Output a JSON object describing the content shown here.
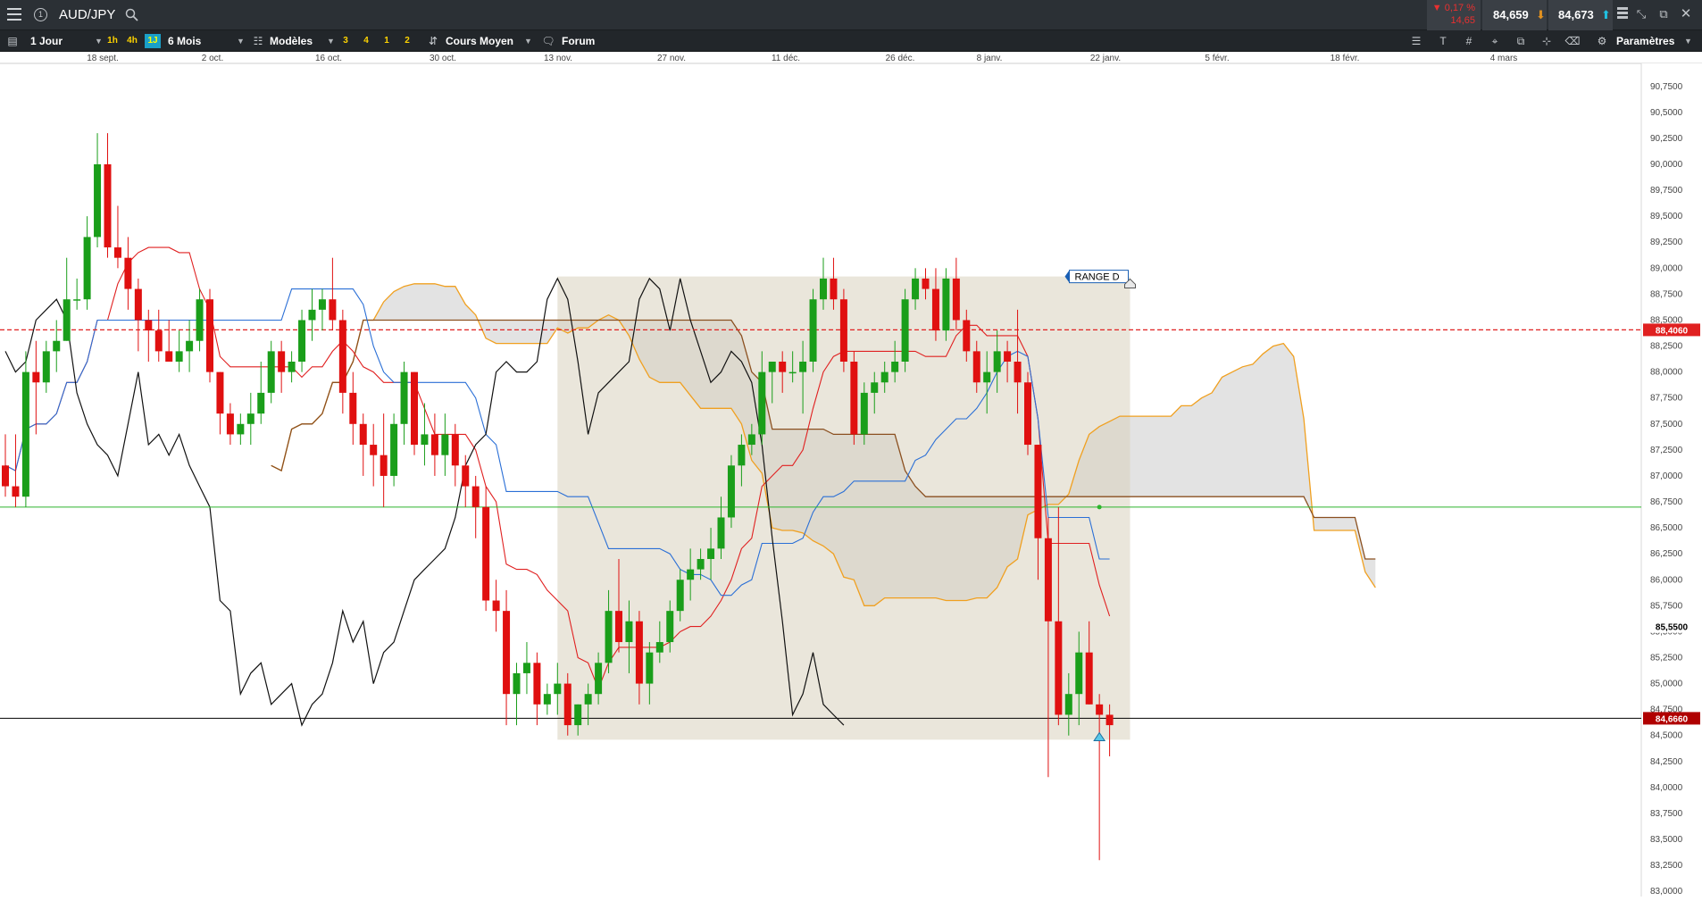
{
  "header": {
    "symbol": "AUD/JPY",
    "change_pct": "▼ 0,17 %",
    "change_pts": "14,65",
    "sell_price": "84,659",
    "buy_price": "84,673"
  },
  "toolbar": {
    "timeframe": "1 Jour",
    "quick_1h": "1h",
    "quick_4h": "4h",
    "quick_1j": "1J",
    "period": "6 Mois",
    "templates": "Modèles",
    "preset_3": "3",
    "preset_4": "4",
    "preset_1": "1",
    "preset_2": "2",
    "price_type": "Cours Moyen",
    "forum": "Forum",
    "settings": "Paramètres"
  },
  "chart_data": {
    "type": "candlestick",
    "symbol": "AUD/JPY",
    "x_tick_labels": [
      "18 sept.",
      "2 oct.",
      "16 oct.",
      "30 oct.",
      "13 nov.",
      "27 nov.",
      "11 déc.",
      "26 déc.",
      "8 janv.",
      "22 janv.",
      "5 févr.",
      "18 févr.",
      "4 mars"
    ],
    "y_tick_labels": [
      "90,7500",
      "90,5000",
      "90,2500",
      "90,0000",
      "89,7500",
      "89,5000",
      "89,2500",
      "89,0000",
      "88,7500",
      "88,5000",
      "88,2500",
      "88,0000",
      "87,7500",
      "87,5000",
      "87,2500",
      "87,0000",
      "86,7500",
      "86,5000",
      "86,2500",
      "86,0000",
      "85,7500",
      "85,5000",
      "85,2500",
      "85,0000",
      "84,7500",
      "84,5000",
      "84,2500",
      "84,0000",
      "83,7500",
      "83,5000",
      "83,2500",
      "83,0000"
    ],
    "ylim": [
      82.95,
      90.92
    ],
    "horizontal_lines": {
      "resistance": {
        "value": 88.406,
        "label": "88,4060",
        "color": "#e02020",
        "style": "dashed"
      },
      "alert_level": {
        "value": 85.55,
        "label": "85,5500",
        "color": "#000000"
      },
      "current_price": {
        "value": 84.666,
        "label": "84,6660",
        "color": "#b00000"
      },
      "green_level": {
        "value": 86.7,
        "color": "#2db52d"
      }
    },
    "range_box": {
      "label": "RANGE D",
      "top": 88.92,
      "bottom": 84.46,
      "color": "#d8d2bd"
    },
    "colors": {
      "up": "#1a9e1a",
      "down": "#e01010",
      "tenkan": "#e02020",
      "kijun": "#2a6fd6",
      "chikou": "#111111",
      "senkou_a": "#f0a020",
      "senkou_b": "#8b5020",
      "cloud": "#d9d9d9"
    },
    "candles": [
      [
        87.1,
        87.4,
        86.8,
        86.9
      ],
      [
        86.9,
        87.4,
        86.7,
        86.8
      ],
      [
        86.8,
        88.2,
        86.7,
        88.0
      ],
      [
        88.0,
        88.3,
        87.4,
        87.9
      ],
      [
        87.9,
        88.3,
        87.8,
        88.2
      ],
      [
        88.2,
        88.5,
        88.0,
        88.3
      ],
      [
        88.3,
        89.1,
        88.3,
        88.7
      ],
      [
        88.7,
        88.9,
        88.6,
        88.7
      ],
      [
        88.7,
        89.5,
        88.6,
        89.3
      ],
      [
        89.3,
        90.3,
        89.2,
        90.0
      ],
      [
        90.0,
        90.3,
        89.1,
        89.2
      ],
      [
        89.2,
        89.6,
        89.0,
        89.1
      ],
      [
        89.1,
        89.3,
        88.6,
        88.8
      ],
      [
        88.8,
        88.9,
        88.2,
        88.5
      ],
      [
        88.5,
        88.6,
        88.1,
        88.4
      ],
      [
        88.4,
        88.6,
        88.1,
        88.2
      ],
      [
        88.2,
        88.5,
        88.1,
        88.1
      ],
      [
        88.1,
        88.4,
        88.0,
        88.2
      ],
      [
        88.2,
        88.5,
        88.0,
        88.3
      ],
      [
        88.3,
        88.8,
        88.2,
        88.7
      ],
      [
        88.7,
        88.8,
        87.9,
        88.0
      ],
      [
        88.0,
        88.0,
        87.4,
        87.6
      ],
      [
        87.6,
        87.7,
        87.3,
        87.4
      ],
      [
        87.4,
        87.6,
        87.3,
        87.5
      ],
      [
        87.5,
        87.8,
        87.3,
        87.6
      ],
      [
        87.6,
        88.1,
        87.5,
        87.8
      ],
      [
        87.8,
        88.3,
        87.7,
        88.2
      ],
      [
        88.2,
        88.3,
        87.8,
        88.0
      ],
      [
        88.0,
        88.2,
        87.9,
        88.1
      ],
      [
        88.1,
        88.6,
        88.0,
        88.5
      ],
      [
        88.5,
        88.8,
        88.3,
        88.6
      ],
      [
        88.6,
        88.8,
        88.4,
        88.7
      ],
      [
        88.7,
        89.1,
        88.4,
        88.5
      ],
      [
        88.5,
        88.6,
        87.6,
        87.8
      ],
      [
        87.8,
        88.0,
        87.3,
        87.5
      ],
      [
        87.5,
        87.6,
        87.0,
        87.3
      ],
      [
        87.3,
        87.5,
        86.9,
        87.2
      ],
      [
        87.2,
        87.6,
        86.7,
        87.0
      ],
      [
        87.0,
        87.6,
        86.9,
        87.5
      ],
      [
        87.5,
        88.1,
        87.3,
        88.0
      ],
      [
        88.0,
        88.0,
        87.2,
        87.3
      ],
      [
        87.3,
        87.7,
        87.1,
        87.4
      ],
      [
        87.4,
        87.6,
        87.0,
        87.2
      ],
      [
        87.2,
        87.6,
        87.0,
        87.4
      ],
      [
        87.4,
        87.5,
        86.9,
        87.1
      ],
      [
        87.1,
        87.2,
        86.7,
        86.9
      ],
      [
        86.9,
        87.0,
        86.4,
        86.7
      ],
      [
        86.7,
        86.9,
        85.7,
        85.8
      ],
      [
        85.8,
        86.0,
        85.5,
        85.7
      ],
      [
        85.7,
        85.9,
        84.6,
        84.9
      ],
      [
        84.9,
        85.2,
        84.6,
        85.1
      ],
      [
        85.1,
        85.4,
        84.9,
        85.2
      ],
      [
        85.2,
        85.3,
        84.6,
        84.8
      ],
      [
        84.8,
        85.0,
        84.7,
        84.9
      ],
      [
        84.9,
        85.2,
        84.7,
        85.0
      ],
      [
        85.0,
        85.1,
        84.5,
        84.6
      ],
      [
        84.6,
        84.8,
        84.5,
        84.8
      ],
      [
        84.8,
        85.0,
        84.6,
        84.9
      ],
      [
        84.9,
        85.3,
        84.8,
        85.2
      ],
      [
        85.2,
        85.9,
        85.1,
        85.7
      ],
      [
        85.7,
        86.2,
        85.3,
        85.4
      ],
      [
        85.4,
        85.8,
        85.1,
        85.6
      ],
      [
        85.6,
        85.7,
        84.8,
        85.0
      ],
      [
        85.0,
        85.4,
        84.8,
        85.3
      ],
      [
        85.3,
        85.6,
        85.2,
        85.4
      ],
      [
        85.4,
        85.8,
        85.3,
        85.7
      ],
      [
        85.7,
        86.1,
        85.6,
        86.0
      ],
      [
        86.0,
        86.3,
        85.8,
        86.1
      ],
      [
        86.1,
        86.3,
        86.0,
        86.2
      ],
      [
        86.2,
        86.5,
        86.0,
        86.3
      ],
      [
        86.3,
        86.8,
        86.2,
        86.6
      ],
      [
        86.6,
        87.2,
        86.5,
        87.1
      ],
      [
        87.1,
        87.4,
        86.9,
        87.3
      ],
      [
        87.3,
        87.5,
        87.2,
        87.4
      ],
      [
        87.4,
        88.2,
        87.3,
        88.0
      ],
      [
        88.0,
        88.1,
        87.7,
        88.1
      ],
      [
        88.1,
        88.2,
        87.8,
        88.0
      ],
      [
        88.0,
        88.2,
        87.9,
        88.0
      ],
      [
        88.0,
        88.3,
        87.6,
        88.1
      ],
      [
        88.1,
        88.8,
        88.0,
        88.7
      ],
      [
        88.7,
        89.1,
        88.6,
        88.9
      ],
      [
        88.9,
        89.1,
        88.6,
        88.7
      ],
      [
        88.7,
        88.8,
        88.0,
        88.1
      ],
      [
        88.1,
        88.2,
        87.3,
        87.4
      ],
      [
        87.4,
        87.9,
        87.3,
        87.8
      ],
      [
        87.8,
        88.0,
        87.6,
        87.9
      ],
      [
        87.9,
        88.1,
        87.8,
        88.0
      ],
      [
        88.0,
        88.3,
        87.9,
        88.1
      ],
      [
        88.1,
        88.8,
        88.0,
        88.7
      ],
      [
        88.7,
        89.0,
        88.6,
        88.9
      ],
      [
        88.9,
        89.0,
        88.7,
        88.8
      ],
      [
        88.8,
        89.0,
        88.3,
        88.4
      ],
      [
        88.4,
        89.0,
        88.3,
        88.9
      ],
      [
        88.9,
        89.1,
        88.4,
        88.5
      ],
      [
        88.5,
        88.6,
        88.1,
        88.2
      ],
      [
        88.2,
        88.3,
        87.8,
        87.9
      ],
      [
        87.9,
        88.2,
        87.6,
        88.0
      ],
      [
        88.0,
        88.4,
        87.8,
        88.2
      ],
      [
        88.2,
        88.3,
        87.9,
        88.1
      ],
      [
        88.1,
        88.6,
        87.6,
        87.9
      ],
      [
        87.9,
        88.0,
        87.2,
        87.3
      ],
      [
        87.3,
        87.3,
        86.0,
        86.4
      ],
      [
        86.4,
        86.6,
        84.1,
        85.6
      ],
      [
        85.6,
        86.7,
        84.6,
        84.7
      ],
      [
        84.7,
        85.1,
        84.5,
        84.9
      ],
      [
        84.9,
        85.5,
        84.6,
        85.3
      ],
      [
        85.3,
        85.6,
        84.8,
        84.8
      ],
      [
        84.8,
        84.9,
        83.3,
        84.7
      ],
      [
        84.7,
        84.8,
        84.3,
        84.6
      ]
    ]
  }
}
